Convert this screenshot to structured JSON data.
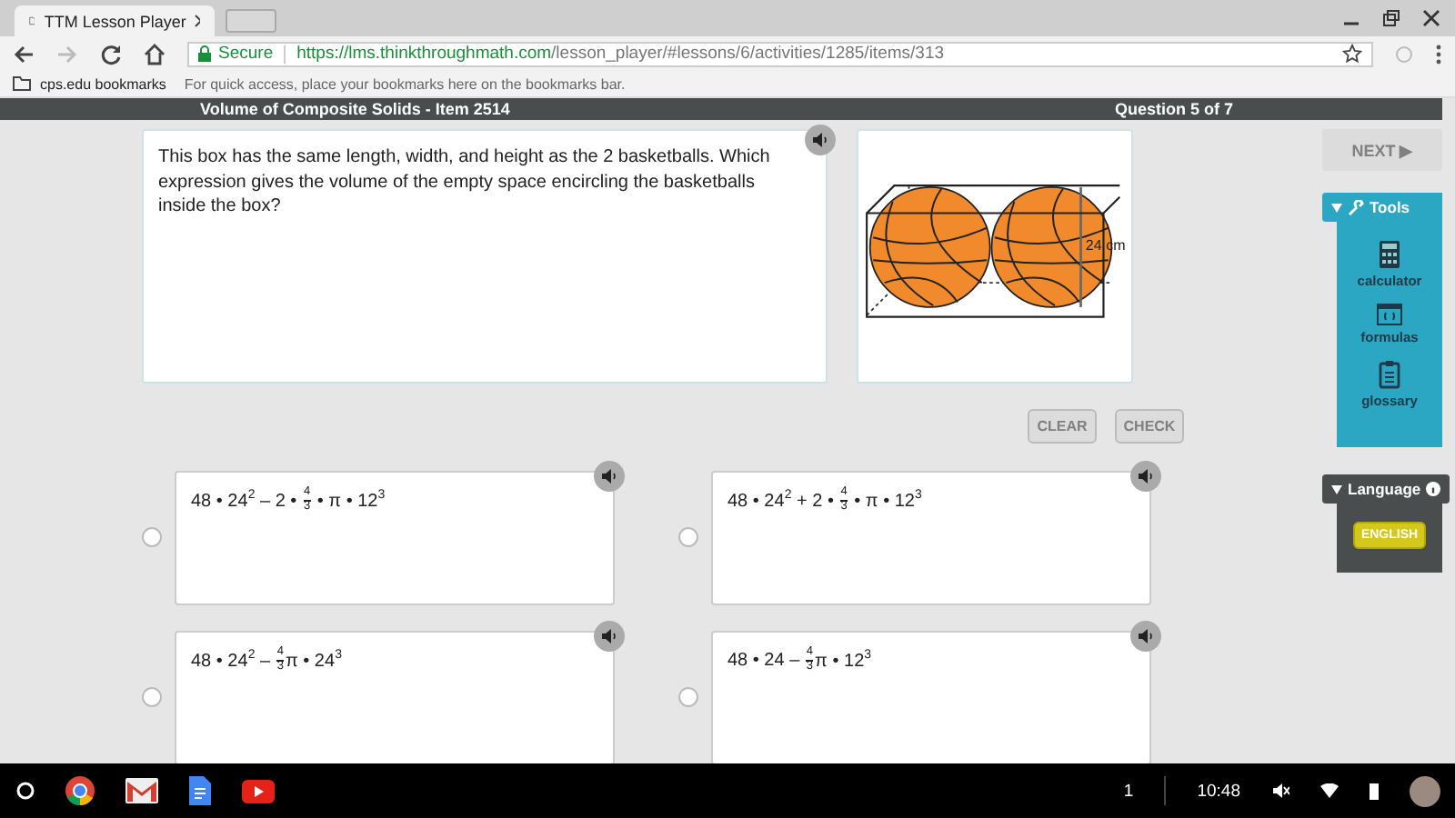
{
  "browser": {
    "tabs": [
      {
        "title": "TTM Lesson Player",
        "selected": true
      }
    ],
    "secure_label": "Secure",
    "url_host": "https://lms.thinkthroughmath.com",
    "url_path": "/lesson_player/#lessons/6/activities/1285/items/313",
    "bookmarks_folder": "cps.edu bookmarks",
    "bookmarks_hint": "For quick access, place your bookmarks here on the bookmarks bar."
  },
  "header": {
    "title": "Volume of Composite Solids - Item 2514",
    "progress": "Question 5 of 7"
  },
  "question": {
    "text": "This box has the same length, width, and height as the 2 basketballs. Which expression gives the volume of the empty space encircling the basketballs inside the box?",
    "figure_label": "24 cm"
  },
  "actions": [
    {
      "label": "CLEAR",
      "disabled": true
    },
    {
      "label": "CHECK",
      "disabled": true
    }
  ],
  "choices": [
    {
      "selected": false,
      "parts": [
        {
          "kind": "text",
          "text": "48 • 24$^{2}$ – 2 • "
        },
        {
          "kind": "frac",
          "num": "4",
          "den": "3"
        },
        {
          "kind": "text",
          "text": " • π • 12$^{3}$"
        }
      ]
    },
    {
      "selected": false,
      "parts": [
        {
          "kind": "text",
          "text": "48 • 24$^{2}$ + 2 • "
        },
        {
          "kind": "frac",
          "num": "4",
          "den": "3"
        },
        {
          "kind": "text",
          "text": " • π • 12$^{3}$"
        }
      ]
    },
    {
      "selected": false,
      "parts": [
        {
          "kind": "text",
          "text": "48 • 24$^{2}$ – "
        },
        {
          "kind": "frac",
          "num": "4",
          "den": "3"
        },
        {
          "kind": "text",
          "text": "π • 24$^{3}$"
        }
      ]
    },
    {
      "selected": false,
      "parts": [
        {
          "kind": "text",
          "text": "48 • 24 – "
        },
        {
          "kind": "frac",
          "num": "4",
          "den": "3"
        },
        {
          "kind": "text",
          "text": "π • 12$^{3}$"
        }
      ]
    }
  ],
  "next": {
    "label": "NEXT ▶",
    "disabled": true
  },
  "tools": {
    "title": "Tools",
    "items": [
      {
        "kind": "calculator",
        "label": "calculator"
      },
      {
        "kind": "formulas",
        "label": "formulas"
      },
      {
        "kind": "glossary",
        "label": "glossary"
      }
    ]
  },
  "language": {
    "title": "Language",
    "button": "ENGLISH"
  },
  "taskbar": {
    "notifications": "1",
    "time": "10:48"
  }
}
